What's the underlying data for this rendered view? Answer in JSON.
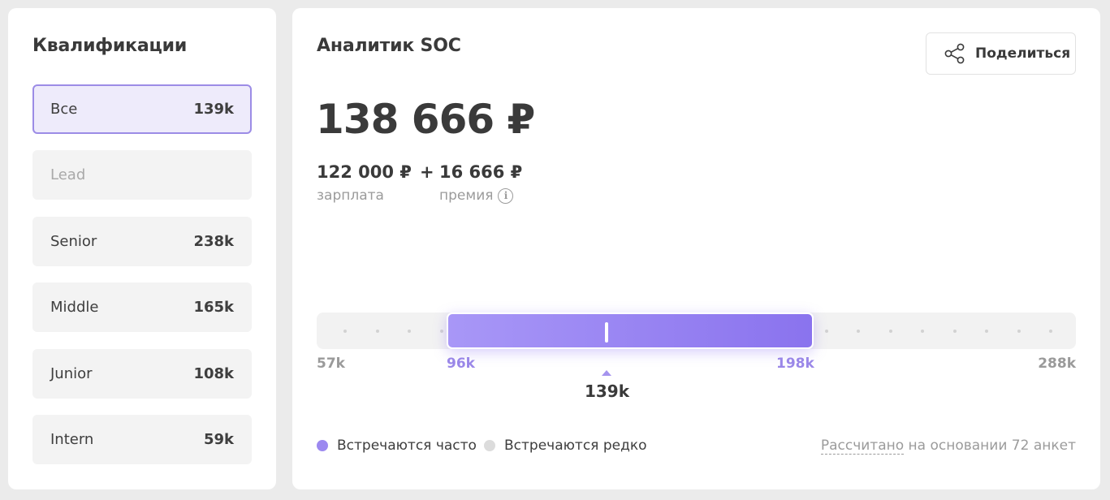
{
  "sidebar": {
    "title": "Квалификации",
    "items": [
      {
        "label": "Все",
        "value": "139k"
      },
      {
        "label": "Lead",
        "value": ""
      },
      {
        "label": "Senior",
        "value": "238k"
      },
      {
        "label": "Middle",
        "value": "165k"
      },
      {
        "label": "Junior",
        "value": "108k"
      },
      {
        "label": "Intern",
        "value": "59k"
      }
    ]
  },
  "main": {
    "title": "Аналитик SOC",
    "share_label": "Поделиться",
    "total": "138 666 ₽",
    "salary_amount": "122 000 ₽",
    "plus": "+",
    "bonus_amount": "16 666 ₽",
    "salary_caption": "зарплата",
    "bonus_caption": "премия",
    "info_glyph": "i"
  },
  "range": {
    "min_label": "57k",
    "low_label": "96k",
    "high_label": "198k",
    "max_label": "288k",
    "median_label": "139k",
    "min": 57,
    "low": 96,
    "high": 198,
    "max": 288,
    "median": 139
  },
  "legend": {
    "often": "Встречаются часто",
    "rare": "Встречаются редко",
    "often_color": "#9c89f0",
    "rare_color": "#dcdcdc"
  },
  "footnote": {
    "link": "Рассчитано",
    "rest": " на основании 72 анкет"
  }
}
